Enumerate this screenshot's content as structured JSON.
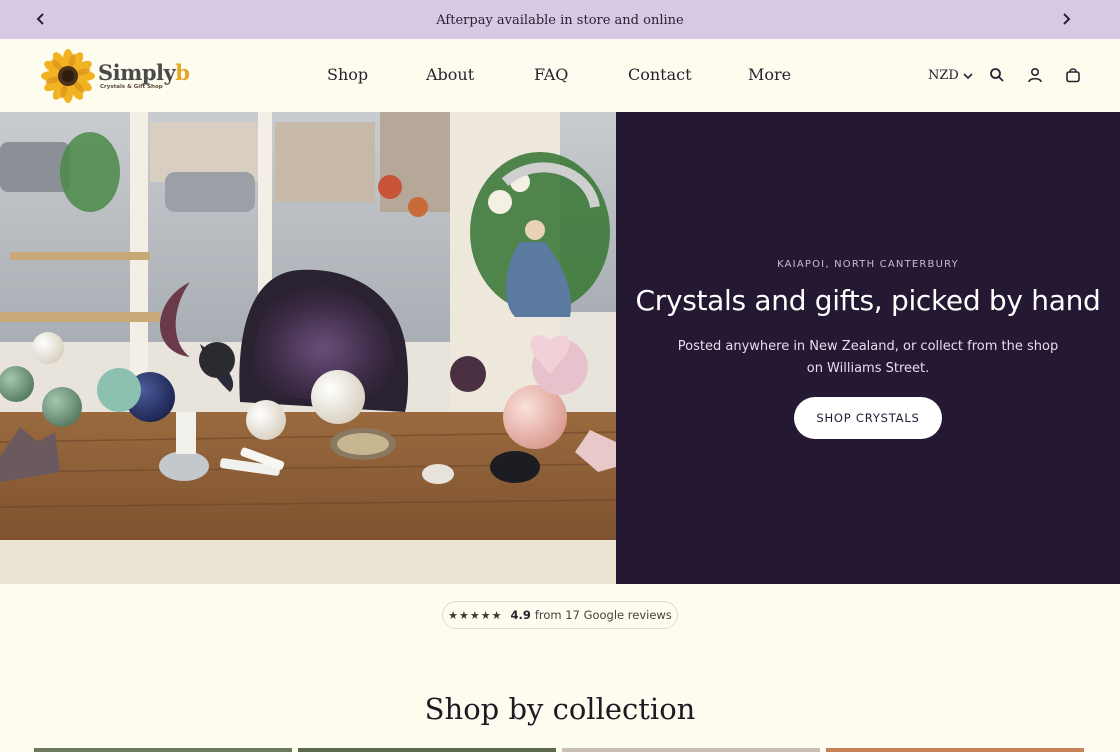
{
  "announcement": {
    "text": "Afterpay available in store and online",
    "prev_icon": "chevron-left-icon",
    "next_icon": "chevron-right-icon"
  },
  "header": {
    "logo": {
      "word_main": "Simply",
      "word_accent": "b",
      "tagline": "Crystals & Gift Shop"
    },
    "nav": [
      "Shop",
      "About",
      "FAQ",
      "Contact",
      "More"
    ],
    "currency": "NZD",
    "icons": [
      "search-icon",
      "account-icon",
      "cart-icon"
    ]
  },
  "hero": {
    "eyebrow": "KAIAPOI, NORTH CANTERBURY",
    "title": "Crystals and gifts, picked by hand",
    "subtitle": "Posted anywhere in New Zealand, or collect from the shop on Williams Street.",
    "button": "SHOP CRYSTALS"
  },
  "reviews": {
    "stars": "★★★★★",
    "rating": "4.9",
    "text": "from 17 Google reviews"
  },
  "collections": {
    "title": "Shop by collection"
  },
  "colors": {
    "announcement_bg": "#d7c8e6",
    "page_bg": "#fdfcef",
    "hero_panel_bg": "#241832",
    "brand_accent": "#e5a52a"
  }
}
